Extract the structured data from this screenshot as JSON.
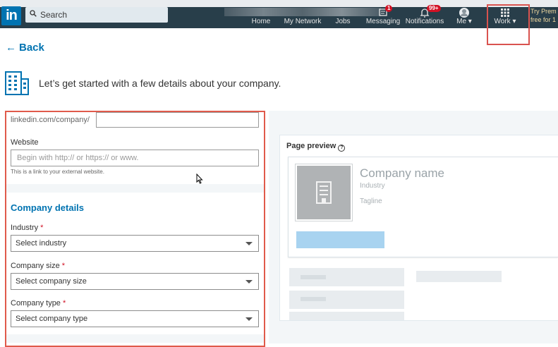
{
  "nav": {
    "logo": "in",
    "search_placeholder": "Search",
    "items": [
      {
        "label": "Home",
        "icon": "home-icon"
      },
      {
        "label": "My Network",
        "icon": "network-icon"
      },
      {
        "label": "Jobs",
        "icon": "jobs-icon"
      },
      {
        "label": "Messaging",
        "icon": "messaging-icon",
        "badge": "1"
      },
      {
        "label": "Notifications",
        "icon": "bell-icon",
        "badge": "99+"
      },
      {
        "label": "Me ▾",
        "icon": "avatar-icon"
      },
      {
        "label": "Work ▾",
        "icon": "grid-icon"
      }
    ],
    "premium_line1": "Try Prem",
    "premium_line2": "free for 1"
  },
  "page": {
    "back_label": "Back",
    "intro": "Let’s get started with a few details about your company."
  },
  "form": {
    "url_prefix": "linkedin.com/company/",
    "url_value": "",
    "website_label": "Website",
    "website_placeholder": "Begin with http:// or https:// or www.",
    "website_hint": "This is a link to your external website.",
    "section_title": "Company details",
    "industry_label": "Industry",
    "industry_value": "Select industry",
    "size_label": "Company size",
    "size_value": "Select company size",
    "type_label": "Company type",
    "type_value": "Select company type",
    "required_mark": "*"
  },
  "preview": {
    "title": "Page preview",
    "help": "?",
    "company_name": "Company name",
    "industry": "Industry",
    "tagline": "Tagline"
  },
  "colors": {
    "nav_bg": "#283e4a",
    "brand": "#0073b1",
    "highlight_border": "#e05a4b",
    "badge": "#d11124"
  }
}
